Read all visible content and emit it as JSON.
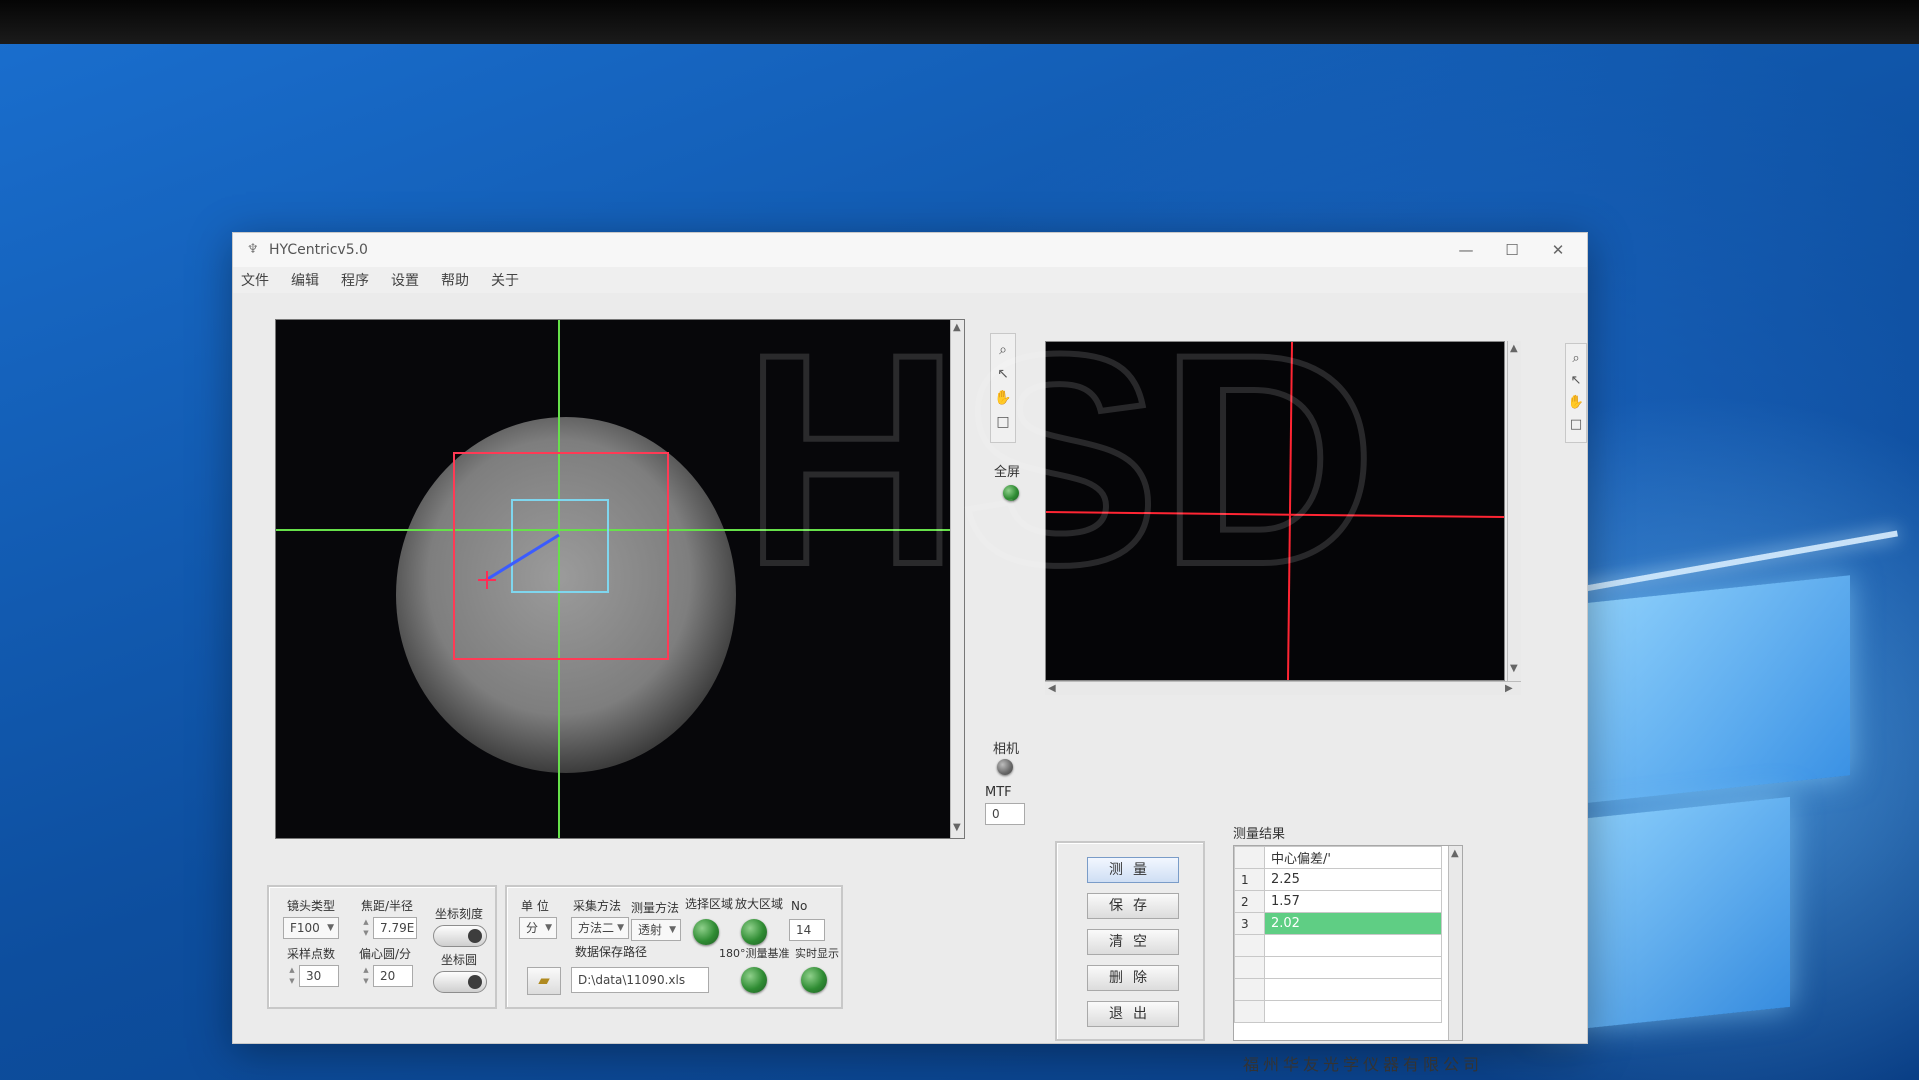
{
  "window": {
    "title": "HYCentricv5.0",
    "controls": [
      "—",
      "☐",
      "✕"
    ]
  },
  "menu": [
    "文件",
    "编辑",
    "程序",
    "设置",
    "帮助",
    "关于"
  ],
  "side": {
    "fullscreen_label": "全屏",
    "camera_label": "相机",
    "mtf_label": "MTF",
    "mtf_value": "0"
  },
  "lens_panel": {
    "lens_type_label": "镜头类型",
    "lens_type_value": "F100",
    "focal_label": "焦距/半径",
    "focal_value": "7.79E",
    "scale_label": "坐标刻度",
    "sample_label": "采样点数",
    "sample_value": "30",
    "ecc_label": "偏心圆/分",
    "ecc_value": "20",
    "coord_circle_label": "坐标圆"
  },
  "acq_panel": {
    "unit_label": "单 位",
    "unit_value": "分",
    "collect_label": "采集方法",
    "collect_value": "方法二",
    "measure_label": "测量方法",
    "measure_value": "透射",
    "select_area_label": "选择区域",
    "zoom_area_label": "放大区域",
    "no_label": "No",
    "no_value": "14",
    "path_label": "数据保存路径",
    "path_value": "D:\\data\\11090.xls",
    "baseline_label": "180°测量基准",
    "realtime_label": "实时显示"
  },
  "buttons": {
    "measure": "测量",
    "save": "保存",
    "clear": "清空",
    "delete": "删除",
    "exit": "退出"
  },
  "results": {
    "title": "测量结果",
    "header": "中心偏差/'",
    "rows": [
      {
        "idx": "1",
        "val": "2.25"
      },
      {
        "idx": "2",
        "val": "1.57"
      },
      {
        "idx": "3",
        "val": "2.02"
      }
    ]
  },
  "company": "福州华友光学仪器有限公司",
  "watermark": "HSD"
}
